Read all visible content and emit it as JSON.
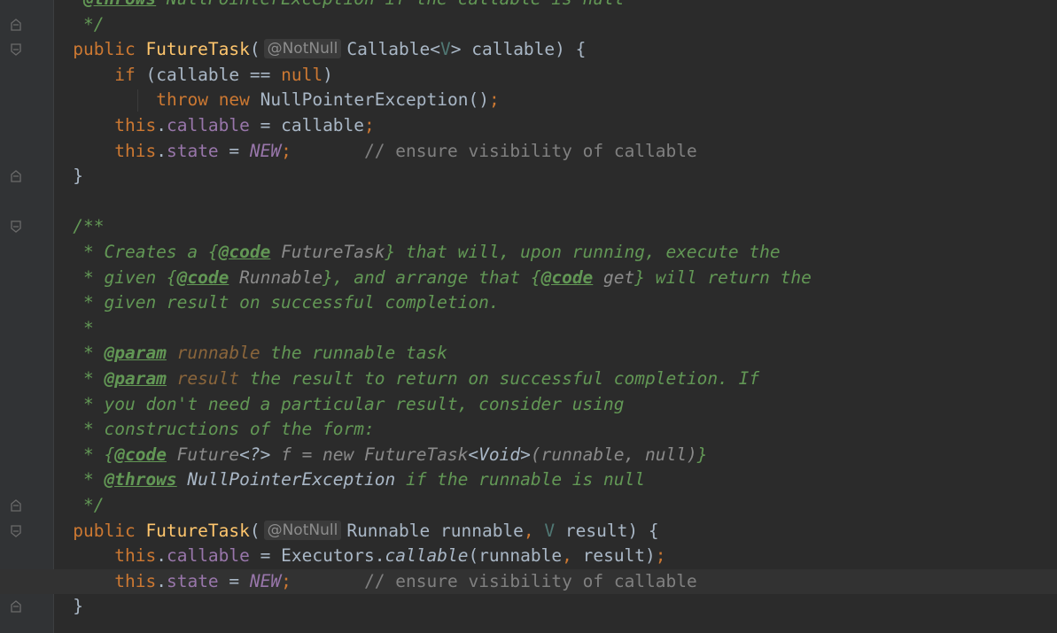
{
  "colors": {
    "background": "#2b2b2b",
    "gutter": "#313335",
    "keyword": "#cc7832",
    "method": "#ffc66d",
    "field": "#9876aa",
    "comment": "#808080",
    "javadoc": "#629755",
    "default_text": "#a9b7c6"
  },
  "gutter": {
    "fold_icons": [
      "fold-end-icon",
      "fold-start-icon",
      "fold-end-icon",
      "fold-start-icon",
      "fold-end-icon",
      "fold-start-icon",
      "fold-end-icon"
    ]
  },
  "code": {
    "lines": [
      {
        "indent": 6,
        "tokens": [
          [
            "doc-tag",
            "@throws"
          ],
          [
            "doc",
            " NullPointerException if the callable is null"
          ]
        ]
      },
      {
        "indent": 6,
        "tokens": [
          [
            "doc",
            "*/"
          ]
        ]
      },
      {
        "indent": 5,
        "tokens": [
          [
            "kw",
            "public "
          ],
          [
            "fn",
            "FutureTask"
          ],
          [
            "",
            "("
          ],
          [
            "ann",
            "@NotNull"
          ],
          [
            "",
            "Callable<"
          ],
          [
            "typ",
            "V"
          ],
          [
            "",
            "> callable) {"
          ]
        ]
      },
      {
        "indent": 9,
        "tokens": [
          [
            "kw",
            "if "
          ],
          [
            "",
            "(callable == "
          ],
          [
            "kw",
            "null"
          ],
          [
            "",
            ")"
          ]
        ]
      },
      {
        "indent": 13,
        "tokens": [
          [
            "kw",
            "throw new "
          ],
          [
            "",
            "NullPointerException()"
          ],
          [
            "kw",
            ";"
          ]
        ]
      },
      {
        "indent": 9,
        "tokens": [
          [
            "kw",
            "this"
          ],
          [
            "",
            "."
          ],
          [
            "fld",
            "callable"
          ],
          [
            "",
            " = callable"
          ],
          [
            "kw",
            ";"
          ]
        ]
      },
      {
        "indent": 9,
        "tokens": [
          [
            "kw",
            "this"
          ],
          [
            "",
            "."
          ],
          [
            "fld",
            "state"
          ],
          [
            "",
            " = "
          ],
          [
            "fld-i",
            "NEW"
          ],
          [
            "kw",
            ";"
          ],
          [
            "cm",
            "       // ensure visibility of callable"
          ]
        ]
      },
      {
        "indent": 5,
        "tokens": [
          [
            "",
            "}"
          ]
        ]
      },
      {
        "indent": 0,
        "tokens": []
      },
      {
        "indent": 5,
        "tokens": [
          [
            "doc",
            "/**"
          ]
        ]
      },
      {
        "indent": 6,
        "tokens": [
          [
            "doc",
            "* Creates a {"
          ],
          [
            "doc-tag",
            "@code"
          ],
          [
            "doc-code",
            " FutureTask"
          ],
          [
            "doc",
            "} that will, upon running, execute the"
          ]
        ]
      },
      {
        "indent": 6,
        "tokens": [
          [
            "doc",
            "* given {"
          ],
          [
            "doc-tag",
            "@code"
          ],
          [
            "doc-code",
            " Runnable"
          ],
          [
            "doc",
            "}, and arrange that {"
          ],
          [
            "doc-tag",
            "@code"
          ],
          [
            "doc-code",
            " get"
          ],
          [
            "doc",
            "} will return the"
          ]
        ]
      },
      {
        "indent": 6,
        "tokens": [
          [
            "doc",
            "* given result on successful completion."
          ]
        ]
      },
      {
        "indent": 6,
        "tokens": [
          [
            "doc",
            "*"
          ]
        ]
      },
      {
        "indent": 6,
        "tokens": [
          [
            "doc",
            "* "
          ],
          [
            "doc-tag",
            "@param"
          ],
          [
            "doc-param",
            " runnable"
          ],
          [
            "doc",
            " the runnable task"
          ]
        ]
      },
      {
        "indent": 6,
        "tokens": [
          [
            "doc",
            "* "
          ],
          [
            "doc-tag",
            "@param"
          ],
          [
            "doc-param",
            " result"
          ],
          [
            "doc",
            " the result to return on successful completion. If"
          ]
        ]
      },
      {
        "indent": 6,
        "tokens": [
          [
            "doc",
            "* you don't need a particular result, consider using"
          ]
        ]
      },
      {
        "indent": 6,
        "tokens": [
          [
            "doc",
            "* constructions of the form:"
          ]
        ]
      },
      {
        "indent": 6,
        "tokens": [
          [
            "doc",
            "* {"
          ],
          [
            "doc-tag",
            "@code"
          ],
          [
            "doc-code",
            " Future"
          ],
          [
            "doc-ref",
            "<?>"
          ],
          [
            "doc-code",
            " f = new FutureTask"
          ],
          [
            "doc-ref",
            "<Void>"
          ],
          [
            "doc-code",
            "(runnable, null)"
          ],
          [
            "doc",
            "}"
          ]
        ]
      },
      {
        "indent": 6,
        "tokens": [
          [
            "doc",
            "* "
          ],
          [
            "doc-tag",
            "@throws"
          ],
          [
            "doc-ref",
            " NullPointerException"
          ],
          [
            "doc",
            " if the runnable is null"
          ]
        ]
      },
      {
        "indent": 6,
        "tokens": [
          [
            "doc",
            "*/"
          ]
        ]
      },
      {
        "indent": 5,
        "tokens": [
          [
            "kw",
            "public "
          ],
          [
            "fn",
            "FutureTask"
          ],
          [
            "",
            "("
          ],
          [
            "ann",
            "@NotNull"
          ],
          [
            "",
            "Runnable runnable"
          ],
          [
            "kw",
            ", "
          ],
          [
            "typ",
            "V"
          ],
          [
            "",
            " result) {"
          ]
        ]
      },
      {
        "indent": 9,
        "tokens": [
          [
            "kw",
            "this"
          ],
          [
            "",
            "."
          ],
          [
            "fld",
            "callable"
          ],
          [
            "",
            " = Executors."
          ],
          [
            "itl",
            "callable"
          ],
          [
            "",
            "(runnable"
          ],
          [
            "kw",
            ", "
          ],
          [
            "",
            "result)"
          ],
          [
            "kw",
            ";"
          ]
        ]
      },
      {
        "indent": 9,
        "tokens": [
          [
            "kw",
            "this"
          ],
          [
            "",
            "."
          ],
          [
            "fld",
            "state"
          ],
          [
            "",
            " = "
          ],
          [
            "fld-i",
            "NEW"
          ],
          [
            "kw",
            ";"
          ],
          [
            "cm",
            "       // ensure visibility of callable"
          ]
        ]
      },
      {
        "indent": 5,
        "tokens": [
          [
            "",
            "}"
          ]
        ]
      }
    ]
  }
}
